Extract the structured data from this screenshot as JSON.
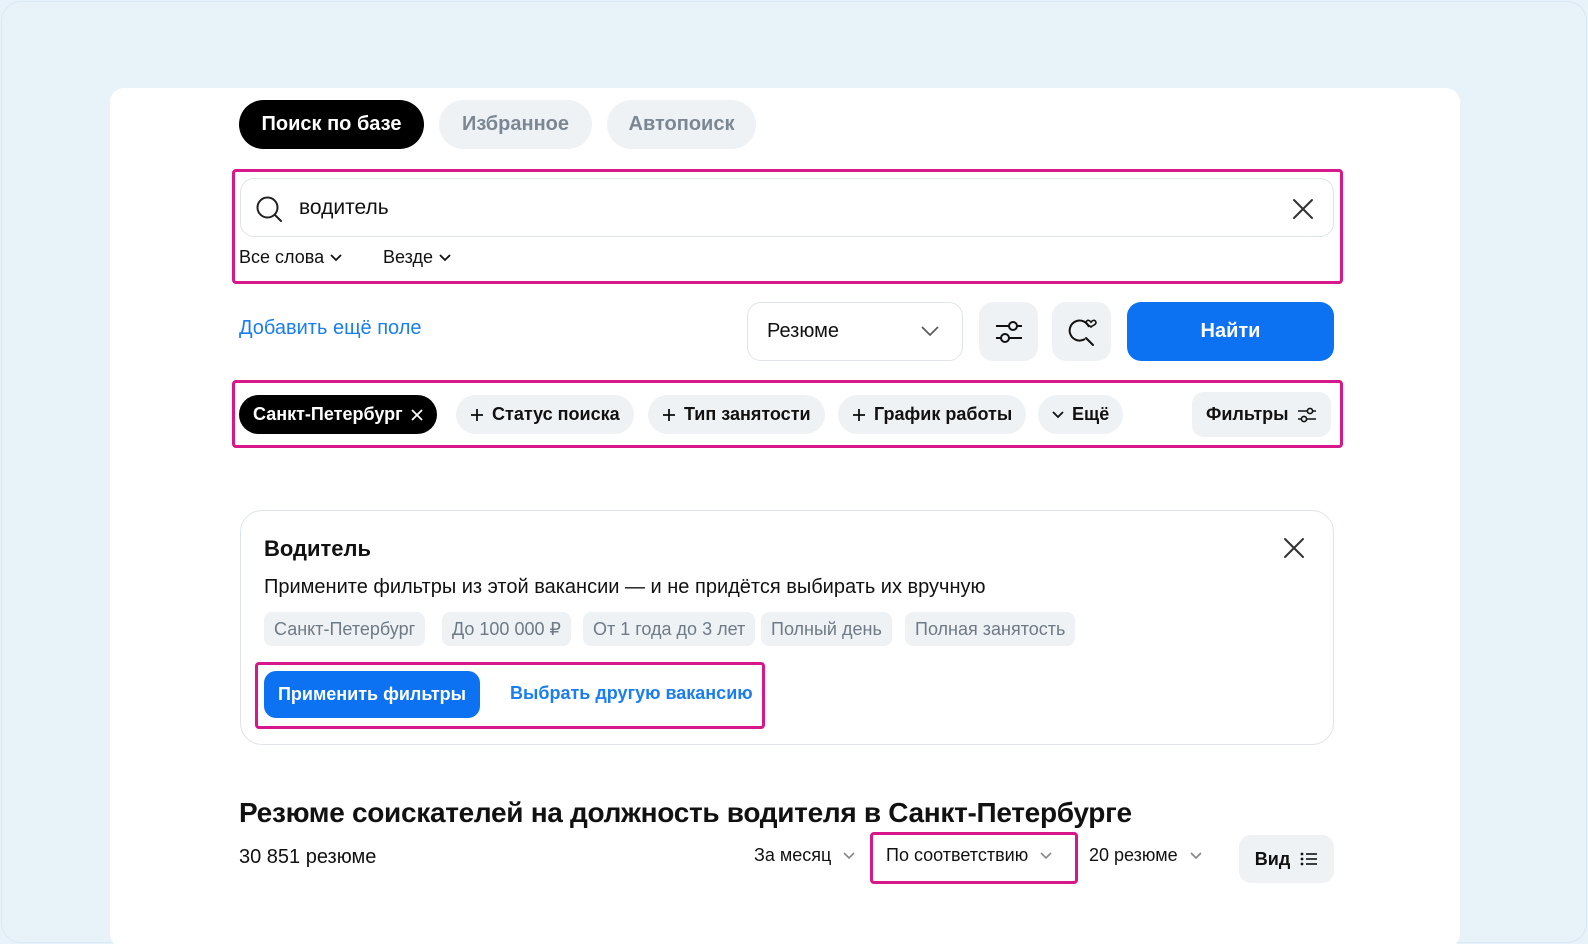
{
  "tabs": [
    {
      "label": "Поиск по базе",
      "active": true
    },
    {
      "label": "Избранное",
      "active": false
    },
    {
      "label": "Автопоиск",
      "active": false
    }
  ],
  "search": {
    "value": "водитель",
    "word_mode": "Все слова",
    "scope": "Везде"
  },
  "add_field_label": "Добавить ещё поле",
  "type_select": {
    "value": "Резюме"
  },
  "find_label": "Найти",
  "chips": {
    "city": "Санкт-Петербург",
    "status": "Статус поиска",
    "employment": "Тип занятости",
    "schedule": "График работы",
    "more": "Ещё",
    "filters": "Фильтры"
  },
  "vacancy": {
    "title": "Водитель",
    "subtitle": "Примените фильтры из этой вакансии — и не придётся выбирать их вручную",
    "tags": [
      "Санкт-Петербург",
      "До 100 000 ₽",
      "От 1 года до 3 лет",
      "Полный день",
      "Полная занятость"
    ],
    "apply_label": "Применить фильтры",
    "other_label": "Выбрать другую вакансию"
  },
  "results": {
    "heading": "Резюме соискателей на должность водителя в Санкт-Петербурге",
    "count": "30 851 резюме",
    "period": "За месяц",
    "sort": "По соответствию",
    "per_page": "20 резюме",
    "view": "Вид"
  },
  "colors": {
    "accent": "#0d72f2",
    "highlight": "#d6188a"
  },
  "icons": {
    "search": "search-icon",
    "clear": "close-icon",
    "settings": "sliders-icon",
    "saved": "search-heart-icon"
  }
}
